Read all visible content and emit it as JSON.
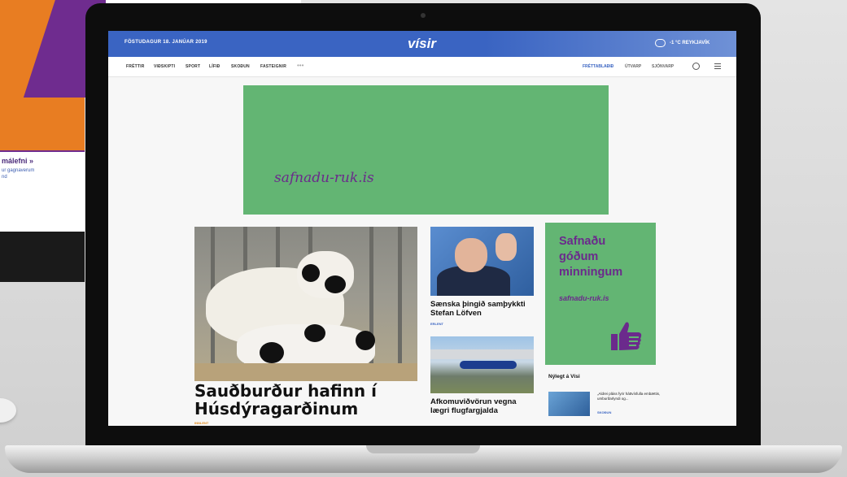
{
  "background": {
    "card_title": "málefni »",
    "card_lines": [
      "ur gagnaverum",
      "nd",
      ""
    ]
  },
  "topbar": {
    "date": "FÖSTUDAGUR 18. JANÚAR 2019",
    "logo": "vísir",
    "weather": "-1 °C REYKJAVÍK",
    "weather_icon": "cloud-icon"
  },
  "nav": {
    "items": [
      "FRÉTTIR",
      "VIÐSKIPTI",
      "SPORT",
      "LÍFIÐ",
      "SKOÐUN",
      "FASTEIGNIR"
    ],
    "more": "•••",
    "right_items": [
      "FRÉTTABLAÐIÐ",
      "ÚTVARP",
      "SJÓNVARP"
    ]
  },
  "ad_banner": {
    "text": "safnadu-ruk.is",
    "bg_color": "#63b573",
    "text_color": "#6b2a8c"
  },
  "main_story": {
    "headline": "Sauðburður hafinn í Húsdýragarðinum",
    "tag": "INNLENT"
  },
  "side_stories": [
    {
      "title": "Sænska þingið samþykkti Stefan Löfven",
      "tag": "ERLENT"
    },
    {
      "title": "Afkomuviðvörun vegna lægri flugfargjalda",
      "tag": ""
    }
  ],
  "ad_box": {
    "headline_lines": [
      "Safnaðu",
      "góðum",
      "minningum"
    ],
    "url": "safnadu-ruk.is",
    "icon": "thumbs-up-icon"
  },
  "recent": {
    "heading": "Nýlegt á Vísi",
    "item_text": "„Aldrei pláss fyrir háttvísfulla embættis, umburðarlyndi og...",
    "item_tag": "SKOÐUN"
  },
  "colors": {
    "brand_blue": "#3a64c2",
    "ad_green": "#63b573",
    "ad_purple": "#6b2a8c"
  }
}
